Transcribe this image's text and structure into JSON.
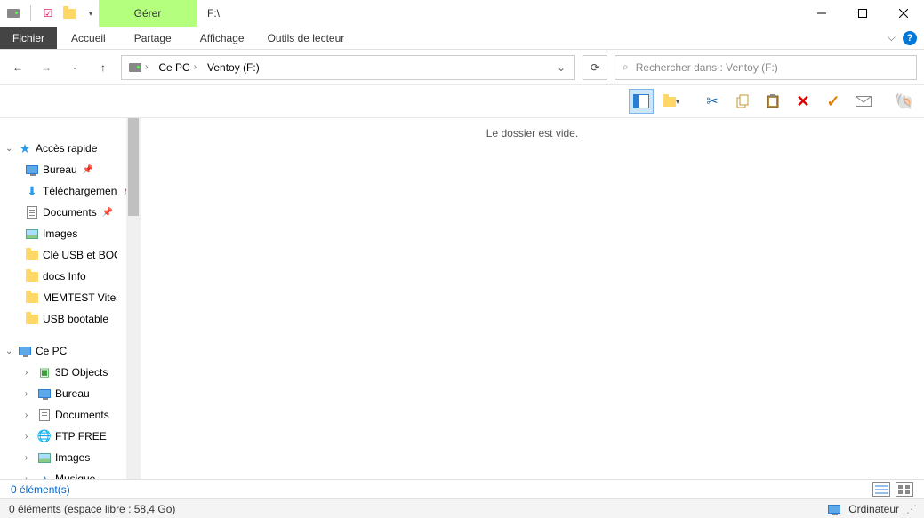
{
  "titlebar": {
    "manage_label": "Gérer",
    "title": "F:\\"
  },
  "ribbon": {
    "file": "Fichier",
    "home": "Accueil",
    "share": "Partage",
    "view": "Affichage",
    "drive_tools": "Outils de lecteur"
  },
  "address": {
    "seg1": "Ce PC",
    "seg2": "Ventoy (F:)"
  },
  "search": {
    "placeholder": "Rechercher dans : Ventoy (F:)"
  },
  "tree": {
    "quick_access": "Accès rapide",
    "items_qa": [
      {
        "label": "Bureau",
        "icon": "monitor",
        "pinned": true
      },
      {
        "label": "Téléchargements",
        "icon": "arrow-down",
        "pinned": true
      },
      {
        "label": "Documents",
        "icon": "doc",
        "pinned": true
      },
      {
        "label": "Images",
        "icon": "img",
        "pinned": false
      },
      {
        "label": "Clé USB et BOOT",
        "icon": "folder",
        "pinned": false
      },
      {
        "label": "docs Info",
        "icon": "folder",
        "pinned": false
      },
      {
        "label": "MEMTEST Vitesse",
        "icon": "folder",
        "pinned": false
      },
      {
        "label": "USB bootable",
        "icon": "folder",
        "pinned": false
      }
    ],
    "this_pc": "Ce PC",
    "items_pc": [
      {
        "label": "3D Objects",
        "icon": "cube"
      },
      {
        "label": "Bureau",
        "icon": "monitor"
      },
      {
        "label": "Documents",
        "icon": "doc"
      },
      {
        "label": "FTP FREE",
        "icon": "globe"
      },
      {
        "label": "Images",
        "icon": "img"
      },
      {
        "label": "Musique",
        "icon": "music"
      }
    ]
  },
  "content": {
    "empty_msg": "Le dossier est vide."
  },
  "status": {
    "line1": "0 élément(s)",
    "line2": "0 éléments (espace libre : 58,4 Go)",
    "computer": "Ordinateur"
  }
}
